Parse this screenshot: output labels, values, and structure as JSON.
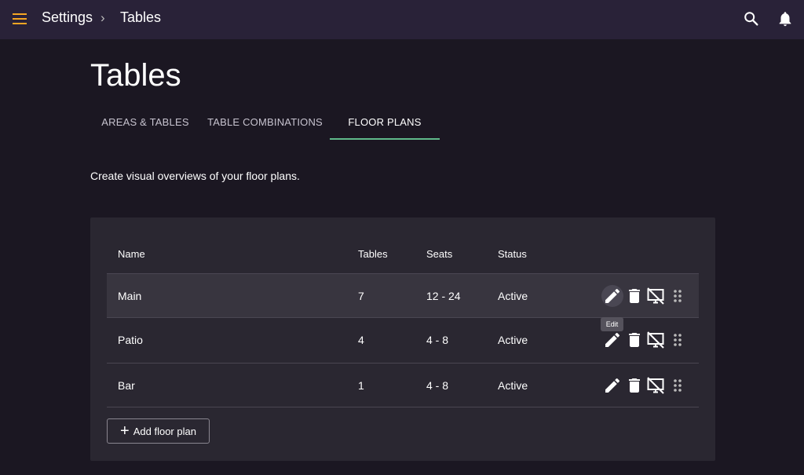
{
  "topbar": {
    "menu_icon": "menu-icon",
    "breadcrumb": [
      "Settings",
      "Tables"
    ],
    "separator": "›",
    "search_icon": "search-icon",
    "notifications_icon": "bell-icon"
  },
  "page": {
    "title": "Tables",
    "tabs": [
      {
        "label": "AREAS & TABLES",
        "active": false
      },
      {
        "label": "TABLE COMBINATIONS",
        "active": false
      },
      {
        "label": "FLOOR PLANS",
        "active": true
      }
    ],
    "description": "Create visual overviews of your floor plans."
  },
  "table": {
    "headers": {
      "name": "Name",
      "tables": "Tables",
      "seats": "Seats",
      "status": "Status"
    },
    "rows": [
      {
        "name": "Main",
        "tables": "7",
        "seats": "12 - 24",
        "status": "Active"
      },
      {
        "name": "Patio",
        "tables": "4",
        "seats": "4 - 8",
        "status": "Active"
      },
      {
        "name": "Bar",
        "tables": "1",
        "seats": "4 - 8",
        "status": "Active"
      }
    ],
    "row_actions": [
      "edit-icon",
      "delete-icon",
      "hide-display-icon",
      "drag-handle-icon"
    ],
    "tooltip": "Edit",
    "add_button": {
      "icon": "plus-icon",
      "label": "Add floor plan"
    }
  },
  "colors": {
    "background": "#1b1722",
    "topbar": "#292238",
    "card": "#2a2731",
    "accent_menu": "#f5a623",
    "tab_indicator": "#5fb98a"
  }
}
